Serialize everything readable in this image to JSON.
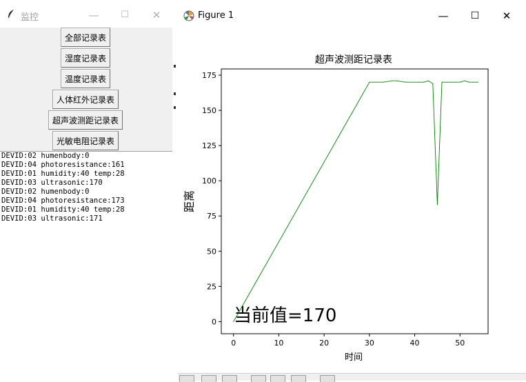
{
  "tk_window": {
    "title": "监控",
    "controls": {
      "minimize": "—",
      "maximize": "☐",
      "close": "✕"
    },
    "buttons": [
      "全部记录表",
      "湿度记录表",
      "温度记录表",
      "人体红外记录表",
      "超声波测距记录表",
      "光敏电阻记录表"
    ],
    "log_lines": [
      "DEVID:02 humenbody:0",
      "DEVID:04 photoresistance:161",
      "DEVID:01 humidity:40 temp:28",
      "DEVID:03 ultrasonic:170",
      "DEVID:02 humenbody:0",
      "DEVID:04 photoresistance:173",
      "DEVID:01 humidity:40 temp:28",
      "DEVID:03 ultrasonic:171"
    ]
  },
  "figure_window": {
    "title": "Figure 1",
    "controls": {
      "minimize": "—",
      "maximize": "☐",
      "close": "✕"
    }
  },
  "chart_data": {
    "type": "line",
    "title": "超声波测距记录表",
    "xlabel": "时间",
    "ylabel": "距离",
    "annotation": "当前值=170",
    "line_color": "#008000",
    "xlim": [
      -2.7,
      56.2
    ],
    "ylim": [
      -8.6,
      179.4
    ],
    "xticks": [
      0,
      10,
      20,
      30,
      40,
      50
    ],
    "yticks": [
      0,
      25,
      50,
      75,
      100,
      125,
      150,
      175
    ],
    "x": [
      0,
      30,
      33,
      35,
      36,
      38,
      41,
      42,
      43,
      44,
      45,
      46,
      47,
      48,
      49,
      50,
      51,
      52,
      53,
      54
    ],
    "y": [
      0,
      170,
      170,
      171,
      171,
      170,
      170,
      170,
      171,
      169,
      83,
      170,
      170,
      170,
      170,
      170,
      171,
      170,
      170,
      170
    ]
  }
}
